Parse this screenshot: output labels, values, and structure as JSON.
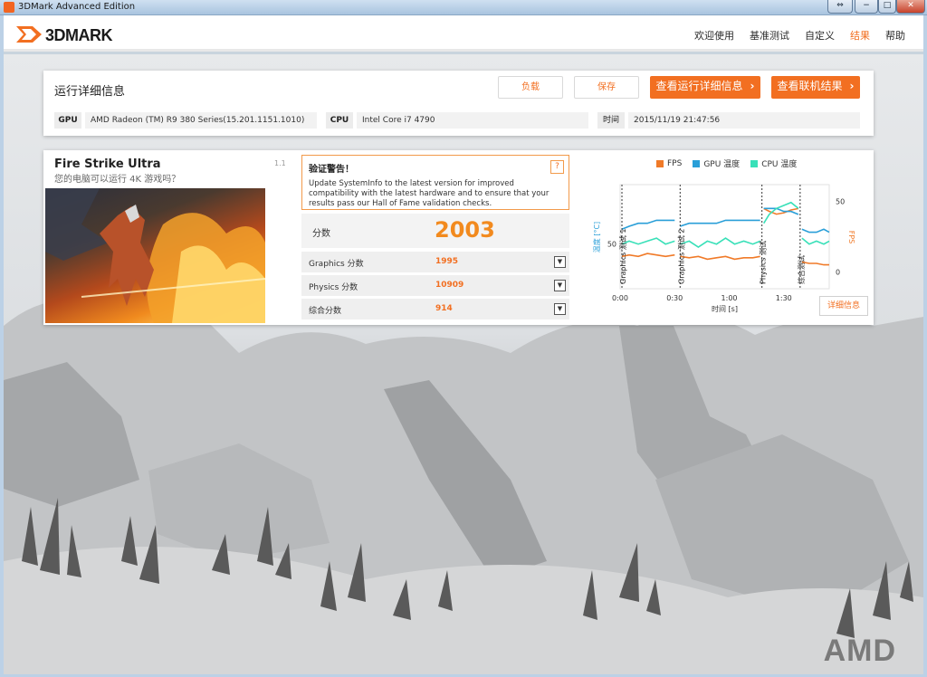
{
  "window": {
    "title": "3DMark Advanced Edition",
    "controls": [
      "⇔",
      "−",
      "□",
      "✕"
    ]
  },
  "app": {
    "logo_text": "3DMARK",
    "nav": [
      {
        "label": "欢迎使用",
        "active": false
      },
      {
        "label": "基准测试",
        "active": false
      },
      {
        "label": "自定义",
        "active": false
      },
      {
        "label": "结果",
        "active": true
      },
      {
        "label": "帮助",
        "active": false
      }
    ]
  },
  "details": {
    "heading": "运行详细信息",
    "buttons": {
      "load": "负载",
      "save": "保存",
      "view_details": "查看运行详细信息",
      "view_online": "查看联机结果"
    },
    "info": {
      "gpu_label": "GPU",
      "gpu_value": "AMD Radeon (TM) R9 380 Series(15.201.1151.1010)",
      "cpu_label": "CPU",
      "cpu_value": "Intel Core i7 4790",
      "time_label": "时间",
      "time_value": "2015/11/19 21:47:56"
    }
  },
  "result": {
    "test_name": "Fire Strike Ultra",
    "version": "1.1",
    "subtitle": "您的电脑可以运行 4K 游戏吗？",
    "warning": {
      "title": "验证警告！",
      "help": "?",
      "text": "Update SystemInfo to the latest version for improved compatibility with the latest hardware and to ensure that your results pass our Hall of Fame validation checks."
    },
    "score_label": "分数",
    "score_value": "2003",
    "sub_scores": [
      {
        "label": "Graphics 分数",
        "value": "1995"
      },
      {
        "label": "Physics 分数",
        "value": "10909"
      },
      {
        "label": "综合分数",
        "value": "914"
      }
    ],
    "expand_glyph": "▼",
    "details_button": "详细信息"
  },
  "colors": {
    "accent": "#f26f21",
    "fps": "#f07a28",
    "gpu_temp": "#2a9fd8",
    "cpu_temp": "#38e0b8"
  },
  "brand_watermark": "AMD",
  "chart_data": {
    "type": "line",
    "legend": [
      "FPS",
      "GPU 温度",
      "CPU 温度"
    ],
    "xlabel": "时间 [s]",
    "ylabel_left": "温度 [°C]",
    "ylabel_right": "FPS",
    "x_ticks": [
      "0:00",
      "0:30",
      "1:00",
      "1:30"
    ],
    "y_left_ticks": [
      "50"
    ],
    "y_right_ticks": [
      "50",
      "0"
    ],
    "xlim": [
      0,
      115
    ],
    "ylim_left": [
      35,
      70
    ],
    "ylim_right": [
      -12,
      62
    ],
    "segments": [
      {
        "label": "Graphics 测试 1",
        "start": 1,
        "end": 32
      },
      {
        "label": "Graphics 测试 2",
        "start": 33,
        "end": 77
      },
      {
        "label": "Physics 测试",
        "start": 78,
        "end": 98
      },
      {
        "label": "综合测试",
        "start": 99,
        "end": 115
      }
    ],
    "series": [
      {
        "name": "FPS",
        "axis": "right",
        "x": [
          1,
          5,
          10,
          15,
          20,
          25,
          30,
          33,
          38,
          43,
          48,
          53,
          58,
          63,
          68,
          73,
          77,
          79,
          82,
          86,
          90,
          94,
          98,
          100,
          104,
          108,
          112,
          115
        ],
        "y": [
          11,
          12,
          11,
          13,
          12,
          11,
          12,
          11,
          10,
          11,
          9,
          10,
          11,
          9,
          10,
          10,
          11,
          45,
          43,
          41,
          42,
          44,
          45,
          7,
          6,
          6,
          5,
          5
        ]
      },
      {
        "name": "GPU 温度",
        "axis": "left",
        "x": [
          1,
          5,
          10,
          15,
          20,
          25,
          30,
          33,
          38,
          43,
          48,
          53,
          58,
          63,
          68,
          73,
          77,
          79,
          82,
          86,
          90,
          94,
          98,
          100,
          104,
          108,
          112,
          115
        ],
        "y": [
          55,
          56,
          57,
          57,
          58,
          58,
          58,
          56,
          57,
          57,
          57,
          57,
          58,
          58,
          58,
          58,
          58,
          62,
          62,
          62,
          61,
          61,
          60,
          55,
          54,
          54,
          55,
          54
        ]
      },
      {
        "name": "CPU 温度",
        "axis": "left",
        "x": [
          1,
          5,
          10,
          15,
          20,
          25,
          30,
          33,
          38,
          43,
          48,
          53,
          58,
          63,
          68,
          73,
          77,
          79,
          82,
          86,
          90,
          94,
          98,
          100,
          104,
          108,
          112,
          115
        ],
        "y": [
          50,
          51,
          50,
          51,
          52,
          50,
          51,
          50,
          51,
          49,
          51,
          50,
          52,
          50,
          51,
          50,
          51,
          57,
          60,
          62,
          63,
          64,
          62,
          52,
          50,
          51,
          50,
          51
        ]
      }
    ]
  }
}
